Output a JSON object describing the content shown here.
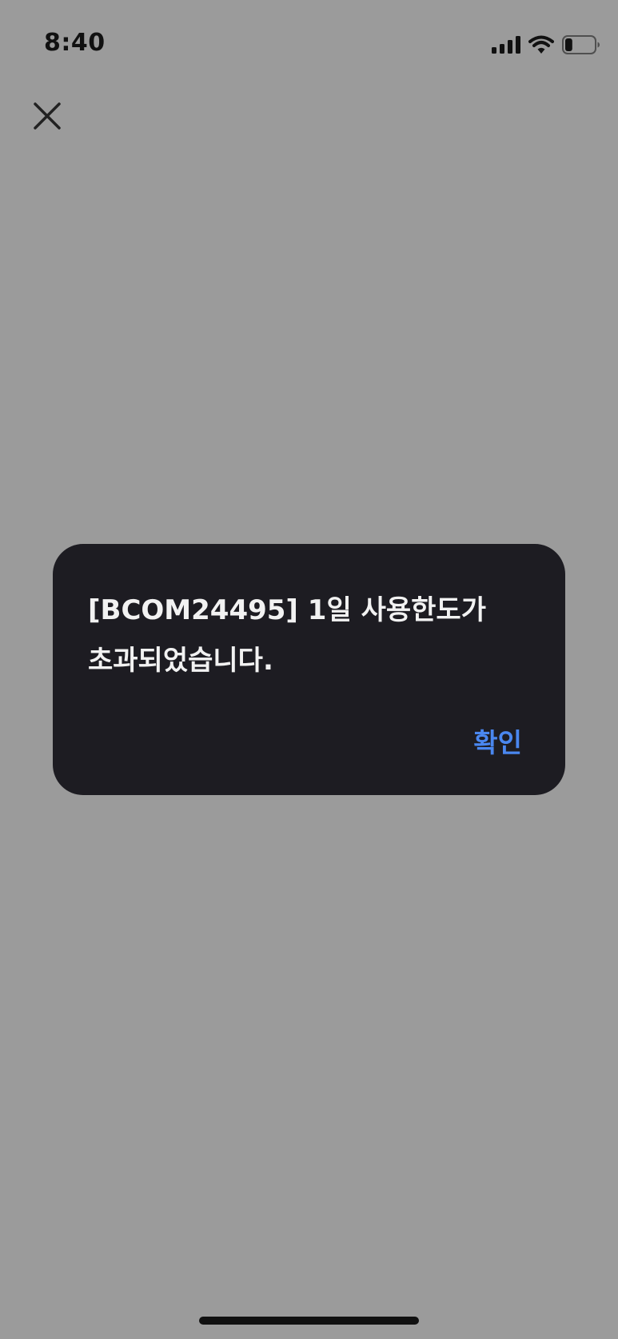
{
  "status_bar": {
    "time": "8:40",
    "icons": [
      "cellular-signal-icon",
      "wifi-icon",
      "battery-icon"
    ],
    "battery_level": 0.25
  },
  "header": {
    "close_icon": "close-icon"
  },
  "dialog": {
    "message": "[BCOM24495] 1일 사용한도가\n초과되었습니다.",
    "confirm_label": "확인"
  },
  "colors": {
    "background": "#9b9b9b",
    "dialog_background": "#1d1c22",
    "dialog_text": "#f2f2f2",
    "accent": "#4a87f0",
    "status_foreground": "#111111"
  }
}
